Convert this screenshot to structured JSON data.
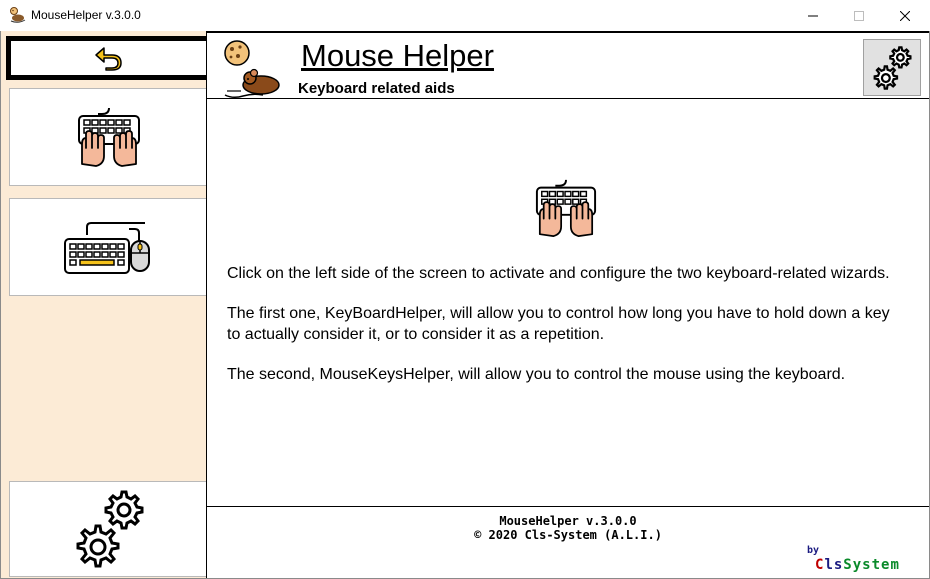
{
  "window": {
    "title": "MouseHelper v.3.0.0",
    "controls": {
      "minimize": "minimize-icon",
      "maximize": "maximize-icon",
      "close": "close-icon"
    }
  },
  "sidebar": {
    "items": [
      {
        "name": "back",
        "icon": "undo-arrow-icon"
      },
      {
        "name": "keyboard-helper",
        "icon": "keyboard-hands-icon"
      },
      {
        "name": "mouse-keys-helper",
        "icon": "keyboard-mouse-icon"
      },
      {
        "name": "settings",
        "icon": "gears-icon"
      }
    ]
  },
  "header": {
    "title": "Mouse Helper",
    "subtitle": "Keyboard related aids",
    "settings_icon": "gears-icon"
  },
  "content": {
    "paragraphs": [
      "Click on the left side of the screen to activate and configure the two keyboard-related wizards.",
      "The first one, KeyBoardHelper, will allow you to control how long you have to hold down a key to actually consider it, or to consider it as a repetition.",
      "The second, MouseKeysHelper, will allow you to control the mouse using the keyboard."
    ]
  },
  "footer": {
    "version": "MouseHelper v.3.0.0",
    "copyright": "© 2020 Cls-System (A.L.I.)",
    "by": "by",
    "brand_parts": [
      "C",
      "ls",
      "System"
    ]
  },
  "colors": {
    "sidebar_bg": "#fcebd6",
    "accent_yellow": "#f5c21b",
    "skin": "#f4b89a",
    "brand_red": "#c00000",
    "brand_blue": "#1a1a80",
    "brand_green": "#0a8a2a"
  }
}
